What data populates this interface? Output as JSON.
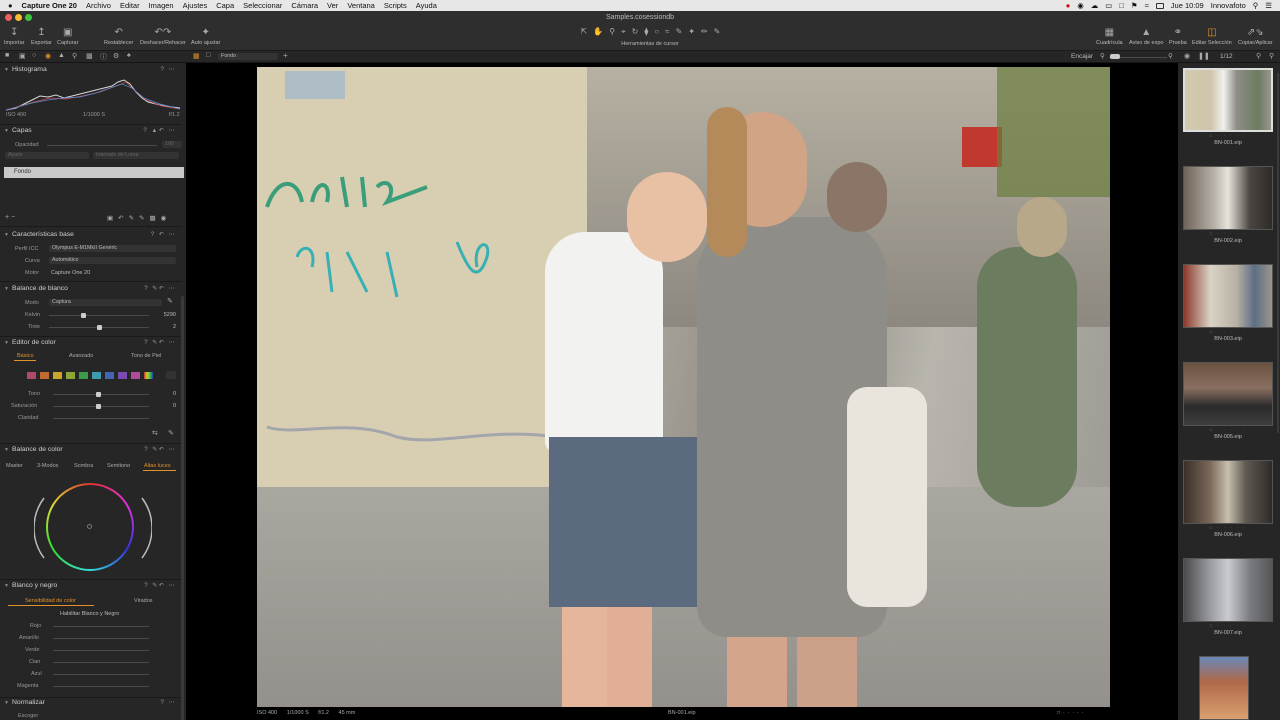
{
  "menubar": {
    "app_name": "Capture One 20",
    "items": [
      "Archivo",
      "Editar",
      "Imagen",
      "Ajustes",
      "Capa",
      "Seleccionar",
      "Cámara",
      "Ver",
      "Ventana",
      "Scripts",
      "Ayuda"
    ],
    "clock": "Jue 10:09",
    "user": "Innovafoto"
  },
  "window": {
    "title": "Samples.cosessiondb"
  },
  "toolbar": {
    "import": "Importar",
    "export": "Exportar",
    "capture": "Capturar",
    "reset": "Restablecer",
    "undo_redo": "Deshacer/Rehacer",
    "auto_adjust": "Auto ajustar",
    "cursor_tools": "Herramientas de cursor",
    "grid": "Cuadrícula",
    "exposure_warning": "Aviso de expo",
    "proof": "Prueba",
    "edit_selection": "Editar Selección",
    "copy_apply": "Copiar/Aplicar"
  },
  "toolrow": {
    "layer_select": "Fondo",
    "fit": "Encajar",
    "counter": "1/12"
  },
  "histogram": {
    "title": "Histograma",
    "iso": "ISO 400",
    "shutter": "1/1000 S",
    "aperture": "f/1.2"
  },
  "layers": {
    "title": "Capas",
    "opacity_label": "Opacidad",
    "opacity_value": "100",
    "adjust_label": "Ajuste",
    "luma_range": "Intervalo de Luma",
    "background_layer": "Fondo"
  },
  "base": {
    "title": "Características base",
    "icc_label": "Perfil ICC",
    "icc_value": "Olympus E-M1MkII Genéric",
    "curve_label": "Curva",
    "curve_value": "Automático",
    "engine_label": "Motor",
    "engine_value": "Capture One 20"
  },
  "white_balance": {
    "title": "Balance de blanco",
    "mode_label": "Modo",
    "mode_value": "Captura",
    "kelvin_label": "Kelvin",
    "kelvin_value": "5290",
    "tint_label": "Tinte",
    "tint_value": "2"
  },
  "color_editor": {
    "title": "Editor de color",
    "tabs": [
      "Básico",
      "Avanzado",
      "Tono de Piel"
    ],
    "swatches": [
      "#b04a6a",
      "#c06c30",
      "#c9a52c",
      "#8ea638",
      "#3f9a4c",
      "#3d9bb0",
      "#4065b5",
      "#7a4bb0",
      "#b04a9a"
    ],
    "hue_label": "Tono",
    "hue_value": "0",
    "saturation_label": "Saturación",
    "saturation_value": "0",
    "clarity_label": "Claridad"
  },
  "color_balance": {
    "title": "Balance de color",
    "tabs": [
      "Master",
      "3-Modos",
      "Sombra",
      "Semitono",
      "Altas luces"
    ]
  },
  "bw": {
    "title": "Blanco y negro",
    "tabs": [
      "Sensibilidad de color",
      "Virados"
    ],
    "enable": "Habilitar Blanco y Negro",
    "channels": [
      "Rojo",
      "Amarillo",
      "Verde",
      "Cian",
      "Azul",
      "Magenta"
    ]
  },
  "normalize": {
    "title": "Normalizar",
    "pick": "Escoger"
  },
  "status": {
    "iso": "ISO 400",
    "shutter": "1/1000 S",
    "aperture": "f/1.2",
    "focal": "45 mm",
    "filename": "BN-001.eip"
  },
  "thumbnails": [
    "BN-001.eip",
    "BN-002.eip",
    "BN-003.eip",
    "BN-005.eip",
    "BN-006.eip",
    "BN-007.eip"
  ],
  "colors": {
    "accent": "#e0912a",
    "panel": "#262626",
    "viewer_bg": "#000000"
  }
}
